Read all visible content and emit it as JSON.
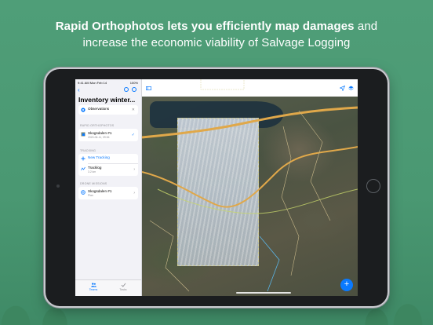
{
  "headline": {
    "bold": "Rapid Orthophotos lets you efficiently map damages",
    "rest_line1": " and",
    "line2": "increase the economic viability of Salvage Logging"
  },
  "status_bar": {
    "time_date": "9:41 AM   Mon Feb 14",
    "right": "100%"
  },
  "sidebar": {
    "title": "Inventory winter...",
    "observations": {
      "label": "Observations"
    },
    "section_orthophotos": "RAPID ORTHOPHOTOS",
    "orthophoto_item": {
      "title": "Skogsdalen #1",
      "subtitle": "2020-06-11, 09:54"
    },
    "section_tracking": "TRACKING",
    "new_tracking": "New Tracking",
    "tracklog_item": {
      "title": "Tracklog",
      "subtitle": "3.2 km"
    },
    "section_drone": "DRONE MISSIONS",
    "drone_item": {
      "title": "Skogsdalen #1",
      "subtitle": "Plan"
    },
    "tabs": [
      {
        "label": "Teams",
        "icon": "people-icon",
        "active": true
      },
      {
        "label": "Tasks",
        "icon": "checkmark-icon",
        "active": false
      }
    ]
  },
  "colors": {
    "accent": "#0a7aff",
    "background": "#4f9e78",
    "road": "#e0a84a",
    "ortho_border": "#d8d49a"
  }
}
